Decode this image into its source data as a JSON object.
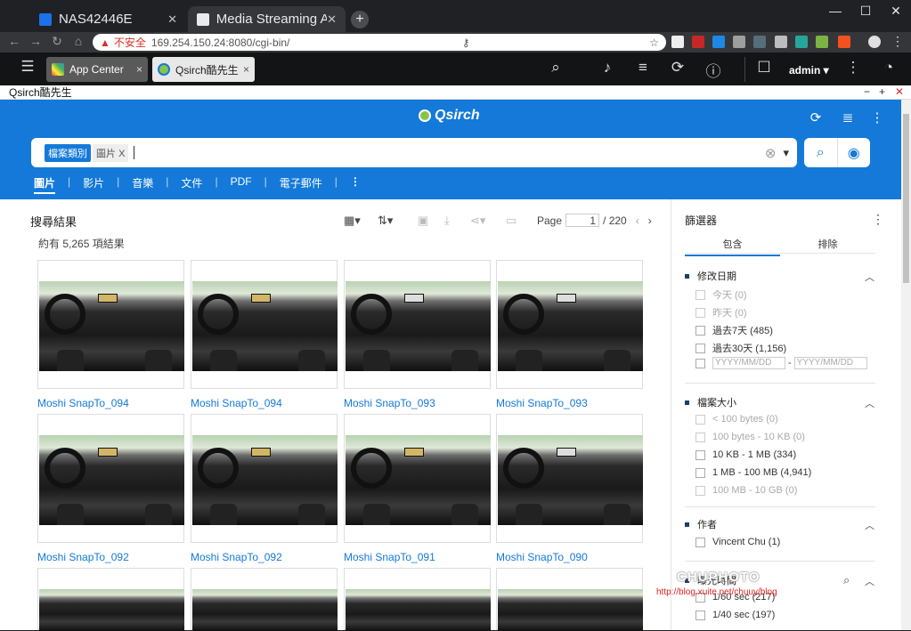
{
  "browser": {
    "tabs": [
      {
        "title": "NAS42446E",
        "active": false
      },
      {
        "title": "Media Streaming A",
        "active": true
      }
    ],
    "new_tab": "+",
    "address": {
      "security": "不安全",
      "url": "169.254.150.24:8080/cgi-bin/"
    },
    "window_controls": [
      "—",
      "☐",
      "✕"
    ]
  },
  "nas": {
    "tabs": [
      {
        "label": "App Center",
        "close": "×"
      },
      {
        "label": "Qsirch酷先生",
        "close": "×"
      }
    ],
    "user": "admin ▾"
  },
  "window": {
    "title": "Qsirch酷先生"
  },
  "header": {
    "logo": "Qsirch",
    "search": {
      "chip_label": "檔案類別",
      "chip_value": "圖片",
      "chip_close": "X",
      "clear": "⊗",
      "dropdown": "▾"
    },
    "categories": [
      "圖片",
      "影片",
      "音樂",
      "文件",
      "PDF",
      "電子郵件"
    ],
    "active_category": "圖片",
    "more": "⋮"
  },
  "results": {
    "title": "搜尋結果",
    "count_text": "約有 5,265 項結果",
    "pager": {
      "label": "Page",
      "current": "1",
      "total": "/ 220"
    },
    "items": [
      {
        "caption": "Moshi SnapTo_094"
      },
      {
        "caption": "Moshi SnapTo_094"
      },
      {
        "caption": "Moshi SnapTo_093"
      },
      {
        "caption": "Moshi SnapTo_093"
      },
      {
        "caption": "Moshi SnapTo_092"
      },
      {
        "caption": "Moshi SnapTo_092"
      },
      {
        "caption": "Moshi SnapTo_091"
      },
      {
        "caption": "Moshi SnapTo_090"
      }
    ]
  },
  "filters": {
    "title": "篩選器",
    "tabs": [
      "包含",
      "排除"
    ],
    "sections": [
      {
        "name": "修改日期",
        "options": [
          {
            "label": "今天 (0)",
            "enabled": false
          },
          {
            "label": "昨天 (0)",
            "enabled": false
          },
          {
            "label": "過去7天 (485)",
            "enabled": true
          },
          {
            "label": "過去30天 (1,156)",
            "enabled": true
          }
        ],
        "date_from": "YYYY/MM/DD",
        "date_to": "YYYY/MM/DD",
        "date_sep": "-"
      },
      {
        "name": "檔案大小",
        "options": [
          {
            "label": "< 100 bytes (0)",
            "enabled": false
          },
          {
            "label": "100 bytes - 10 KB (0)",
            "enabled": false
          },
          {
            "label": "10 KB - 1 MB (334)",
            "enabled": true
          },
          {
            "label": "1 MB - 100 MB (4,941)",
            "enabled": true
          },
          {
            "label": "100 MB - 10 GB (0)",
            "enabled": false
          }
        ]
      },
      {
        "name": "作者",
        "options": [
          {
            "label": "Vincent Chu (1)",
            "enabled": true
          }
        ]
      },
      {
        "name": "曝光時間",
        "options": [
          {
            "label": "1/60 sec (217)",
            "enabled": true
          },
          {
            "label": "1/40 sec (197)",
            "enabled": true
          }
        ]
      }
    ]
  },
  "watermark": {
    "brand": "CHUPHOTO",
    "url": "http://blog.xuite.net/chuuy/blog"
  },
  "colors": {
    "accent": "#1479d9",
    "chrome_dark": "#202124",
    "nas_bar": "#131416"
  }
}
